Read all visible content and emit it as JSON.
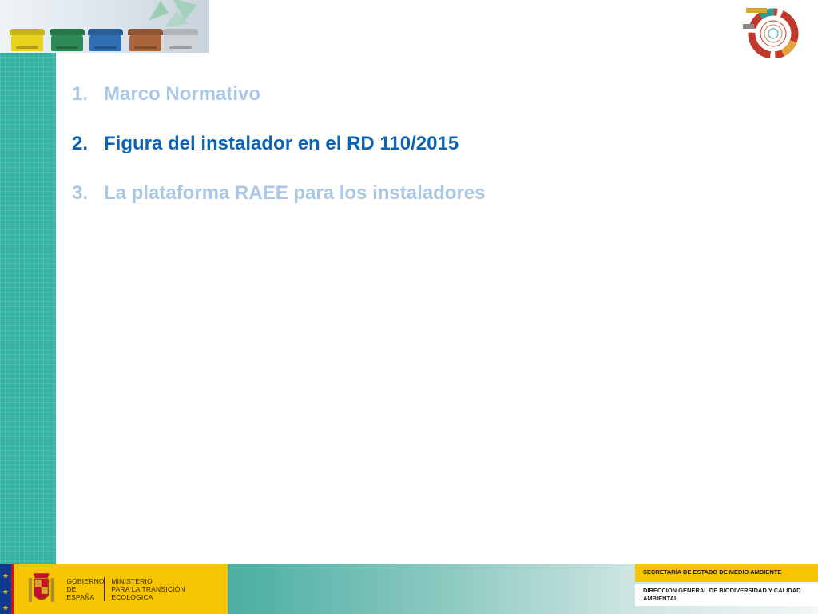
{
  "outline": [
    {
      "number": "1.",
      "text": "Marco Normativo"
    },
    {
      "number": "2.",
      "text": "Figura del instalador en el RD 110/2015"
    },
    {
      "number": "3.",
      "text": "La plataforma RAEE para los instaladores"
    }
  ],
  "footer": {
    "gobierno": "GOBIERNO\nDE ESPAÑA",
    "ministerio": "MINISTERIO\nPARA LA TRANSICIÓN ECOLÓGICA",
    "secretaria": "SECRETARÍA DE ESTADO DE MEDIO AMBIENTE",
    "direccion": "DIRECCION GENERAL DE BIODIVERSIDAD Y CALIDAD AMBIENTAL"
  },
  "colors": {
    "teal": "#36b2a3",
    "active_item": "#0a63b4",
    "muted_item": "#a9c7e6",
    "gov_yellow": "#f6c400"
  }
}
